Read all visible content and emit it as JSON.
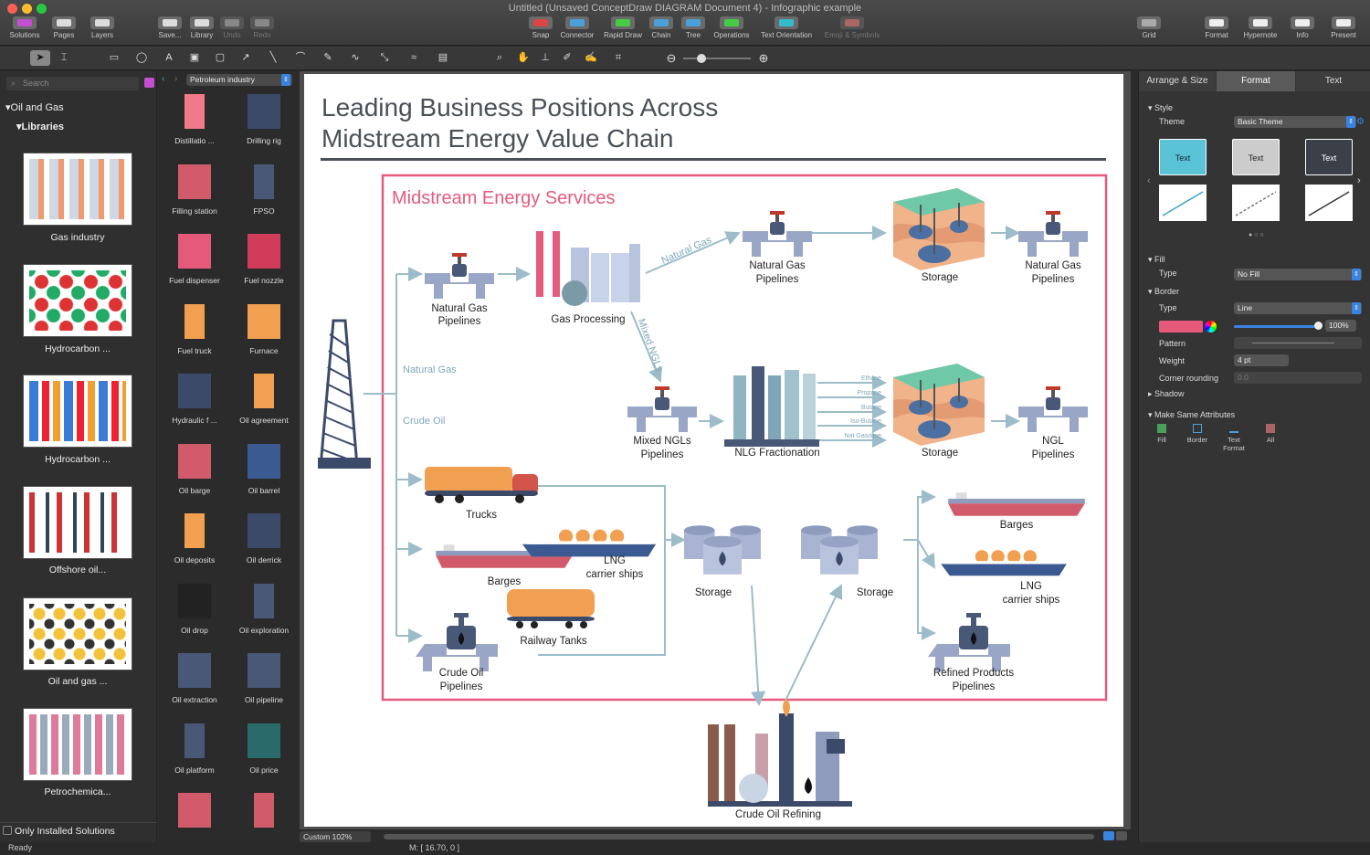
{
  "window": {
    "title": "Untitled (Unsaved ConceptDraw DIAGRAM Document 4) - Infographic example"
  },
  "toolbar": {
    "left": [
      {
        "label": "Solutions"
      },
      {
        "label": "Pages"
      },
      {
        "label": "Layers"
      },
      {
        "label": "Save..."
      },
      {
        "label": "Library"
      },
      {
        "label": "Undo"
      },
      {
        "label": "Redo"
      }
    ],
    "center": [
      {
        "label": "Snap"
      },
      {
        "label": "Connector"
      },
      {
        "label": "Rapid Draw"
      },
      {
        "label": "Chain"
      },
      {
        "label": "Tree"
      },
      {
        "label": "Operations"
      },
      {
        "label": "Text Orientation"
      },
      {
        "label": "Emoji & Symbols"
      }
    ],
    "right": [
      {
        "label": "Grid"
      },
      {
        "label": "Format"
      },
      {
        "label": "Hypernote"
      },
      {
        "label": "Info"
      },
      {
        "label": "Present"
      }
    ]
  },
  "left_panel": {
    "search_placeholder": "Search",
    "tree_root": "Oil and Gas",
    "tree_child": "Libraries",
    "solutions": [
      {
        "label": "Gas industry"
      },
      {
        "label": "Hydrocarbon ..."
      },
      {
        "label": "Hydrocarbon ..."
      },
      {
        "label": "Offshore oil..."
      },
      {
        "label": "Oil and gas ..."
      },
      {
        "label": "Petrochemica..."
      }
    ],
    "only_installed": "Only Installed Solutions"
  },
  "library": {
    "selected": "Petroleum industry",
    "items": [
      "Distillatio ...",
      "Drilling rig",
      "Filling station",
      "FPSO",
      "Fuel dispenser",
      "Fuel nozzle",
      "Fuel truck",
      "Furnace",
      "Hydraulic f ...",
      "Oil agreement",
      "Oil barge",
      "Oil barrel",
      "Oil deposits",
      "Oil derrick",
      "Oil drop",
      "Oil exploration",
      "Oil extraction",
      "Oil pipeline",
      "Oil platform",
      "Oil price",
      "",
      ""
    ]
  },
  "diagram": {
    "title_line1": "Leading Business Positions Across",
    "title_line2": "Midstream Energy Value Chain",
    "box_title": "Midstream Energy Services",
    "labels": {
      "ng_pipe1_a": "Natural Gas",
      "ng_pipe1_b": "Pipelines",
      "gas_processing": "Gas Processing",
      "ng_arrow": "Natural Gas",
      "mixed_ngls_arrow": "Mixed NGLs",
      "ng_pipe2_a": "Natural Gas",
      "ng_pipe2_b": "Pipelines",
      "storage1": "Storage",
      "ng_pipe3_a": "Natural Gas",
      "ng_pipe3_b": "Pipelines",
      "mixed_pipe_a": "Mixed NGLs",
      "mixed_pipe_b": "Pipelines",
      "fractionation": "NLG Fractionation",
      "storage2": "Storage",
      "ngl_pipe_a": "NGL",
      "ngl_pipe_b": "Pipelines",
      "natural_gas_side": "Natural Gas",
      "crude_oil_side": "Crude Oil",
      "trucks": "Trucks",
      "barges1": "Barges",
      "lng1_a": "LNG",
      "lng1_b": "carrier ships",
      "railway": "Railway Tanks",
      "crude_pipe_a": "Crude Oil",
      "crude_pipe_b": "Pipelines",
      "storage3": "Storage",
      "storage4": "Storage",
      "barges2": "Barges",
      "lng2_a": "LNG",
      "lng2_b": "carrier ships",
      "refined_a": "Refined Products",
      "refined_b": "Pipelines",
      "refining": "Crude Oil Refining"
    },
    "fractions": [
      "Ethane",
      "Propane",
      "Butane",
      "Iso-Butane",
      "Nat Gasoline"
    ]
  },
  "zoom": {
    "label": "Custom 102%"
  },
  "right_panel": {
    "tabs": [
      "Arrange & Size",
      "Format",
      "Text"
    ],
    "style_header": "Style",
    "theme_label": "Theme",
    "theme_value": "Basic Theme",
    "swatch_text": "Text",
    "fill_header": "Fill",
    "fill_type_label": "Type",
    "fill_type_value": "No Fill",
    "border_header": "Border",
    "border_type_label": "Type",
    "border_type_value": "Line",
    "opacity": "100%",
    "pattern_label": "Pattern",
    "weight_label": "Weight",
    "weight_value": "4 pt",
    "corner_label": "Corner rounding",
    "corner_value": "0.0",
    "shadow_header": "Shadow",
    "same_header": "Make Same Attributes",
    "same_items": [
      "Fill",
      "Border",
      "Text Format",
      "All"
    ]
  },
  "status": {
    "ready": "Ready",
    "coords": "M: [ 16.70, 0 ]"
  },
  "colors": {
    "accent_pink": "#e55a7b",
    "arrow": "#9bbcc8",
    "label_blue": "#7fa6b8",
    "pipe": "#8a96b8",
    "orange": "#f0a050"
  }
}
